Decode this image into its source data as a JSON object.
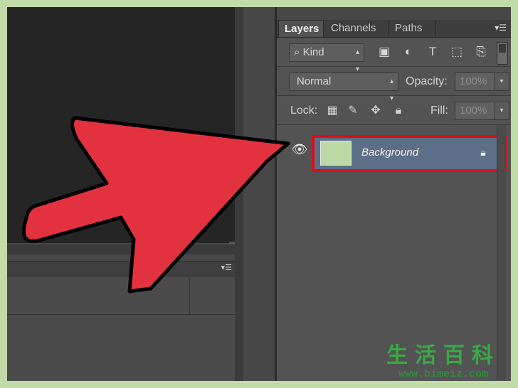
{
  "layers_panel": {
    "tabs": [
      {
        "label": "Layers",
        "active": true
      },
      {
        "label": "Channels",
        "active": false
      },
      {
        "label": "Paths",
        "active": false
      }
    ],
    "filter": {
      "kind_label": "Kind",
      "icons": [
        "image-filter-icon",
        "adjustment-filter-icon",
        "type-filter-icon",
        "shape-filter-icon",
        "smart-object-filter-icon"
      ]
    },
    "blend_mode": "Normal",
    "opacity_label": "Opacity:",
    "opacity_value": "100%",
    "lock_label": "Lock:",
    "lock_icons": [
      "lock-transparent-pixels-icon",
      "lock-image-pixels-icon",
      "lock-position-icon",
      "lock-all-icon"
    ],
    "fill_label": "Fill:",
    "fill_value": "100%",
    "layers": [
      {
        "name": "Background",
        "visible": true,
        "locked": true,
        "thumbnail_color": "#bcd8a5",
        "highlight_color": "#e00d17"
      }
    ]
  },
  "overlay": {
    "arrow_color": "#e3323f"
  },
  "watermark": {
    "chars": "生活百科",
    "url": "www.bimeiz.com"
  },
  "colors": {
    "border": "#c2dba8",
    "panel": "#535353",
    "canvas": "#252525"
  }
}
